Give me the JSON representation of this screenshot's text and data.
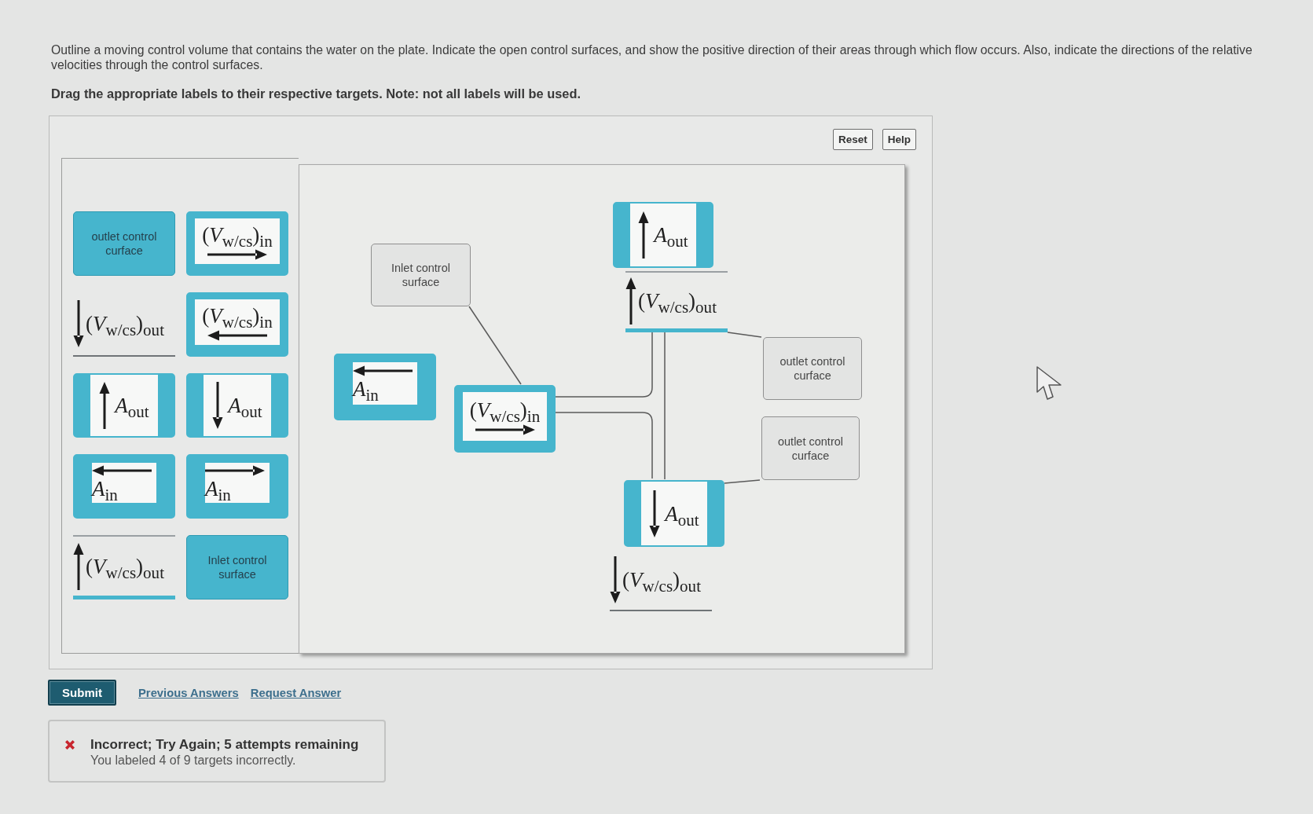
{
  "instructions": {
    "text": "Outline a moving control volume that contains the water on the plate. Indicate the open control surfaces, and show the positive direction of their areas through which flow occurs. Also, indicate the directions of the relative velocities through the control surfaces.",
    "drag_note": "Drag the appropriate labels to their respective targets. Note: not all labels will be used."
  },
  "tool_buttons": [
    "Reset",
    "Help"
  ],
  "label_bank": [
    {
      "kind": "caption",
      "text": "outlet control curface"
    },
    {
      "kind": "velocity_right",
      "text": "(*V*$_{w/cs}$)$_{in}$"
    },
    {
      "kind": "velocity_down",
      "text": "(*V*$_{w/cs}$)$_{out}$"
    },
    {
      "kind": "velocity_left",
      "text": "(*V*$_{w/cs}$)$_{in}$"
    },
    {
      "kind": "area_up",
      "text": "*A*$_{out}$"
    },
    {
      "kind": "area_down",
      "text": "*A*$_{out}$"
    },
    {
      "kind": "area_left",
      "text": "*A*$_{in}$"
    },
    {
      "kind": "area_right",
      "text": "*A*$_{in}$"
    },
    {
      "kind": "velocity_up",
      "text": "(*V*$_{w/cs}$)$_{out}$"
    },
    {
      "kind": "caption",
      "text": "Inlet control surface"
    }
  ],
  "drop_area": {
    "placed_labels": [
      {
        "kind": "area_up",
        "text": "*A*$_{out}$"
      },
      {
        "kind": "caption",
        "text": "Inlet control surface"
      },
      {
        "kind": "velocity_up",
        "text": "(*V*$_{w/cs}$)$_{out}$"
      },
      {
        "kind": "caption",
        "text": "outlet control curface"
      },
      {
        "kind": "area_left",
        "text": "*A*$_{in}$"
      },
      {
        "kind": "velocity_right",
        "text": "(*V*$_{w/cs}$)$_{in}$"
      },
      {
        "kind": "caption",
        "text": "outlet control curface"
      },
      {
        "kind": "area_down",
        "text": "*A*$_{out}$"
      },
      {
        "kind": "velocity_down",
        "text": "(*V*$_{w/cs}$)$_{out}$"
      }
    ]
  },
  "actions": {
    "submit": "Submit",
    "links": [
      "Previous Answers",
      "Request Answer"
    ]
  },
  "feedback": {
    "correct": false,
    "title": "Incorrect; Try Again; 5 attempts remaining",
    "detail": "You labeled 4 of 9 targets incorrectly."
  }
}
